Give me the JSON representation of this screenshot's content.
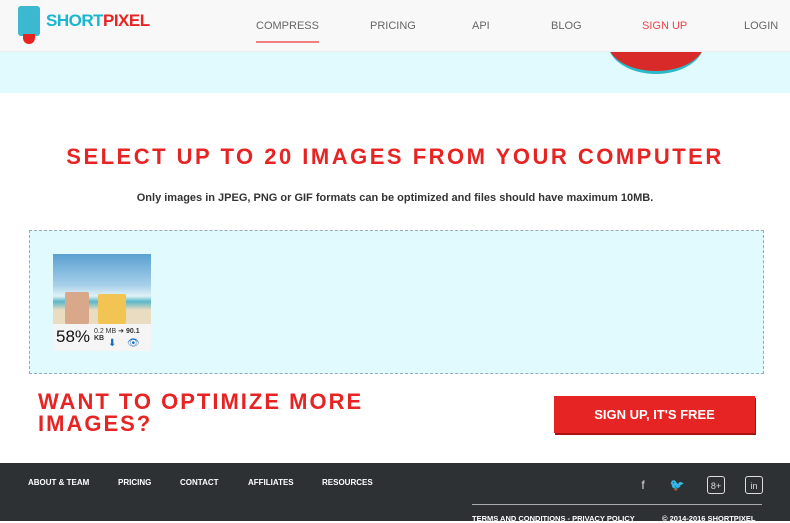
{
  "header": {
    "logo_a": "SHORT",
    "logo_b": "PIXEL",
    "nav": [
      {
        "label": "COMPRESS"
      },
      {
        "label": "PRICING"
      },
      {
        "label": "API"
      },
      {
        "label": "BLOG"
      },
      {
        "label": "SIGN UP"
      },
      {
        "label": "LOGIN"
      }
    ]
  },
  "main": {
    "title": "SELECT UP TO 20 IMAGES FROM YOUR COMPUTER",
    "subtitle": "Only images in JPEG, PNG or GIF formats can be optimized and files should have maximum 10MB.",
    "image": {
      "percent": "58%",
      "before": "0.2 MB",
      "after": "90.1 KB",
      "arrow": "➜"
    },
    "more": "WANT TO OPTIMIZE MORE IMAGES?",
    "cta": "SIGN UP, IT'S FREE"
  },
  "footer": {
    "links": [
      "ABOUT & TEAM",
      "PRICING",
      "CONTACT",
      "AFFILIATES",
      "RESOURCES"
    ],
    "social": [
      "facebook",
      "twitter",
      "google-plus",
      "linkedin"
    ],
    "terms": "TERMS AND CONDITIONS - PRIVACY POLICY",
    "copyright": "© 2014-2016 SHORTPIXEL"
  },
  "colors": {
    "accent": "#e62424",
    "brand_blue": "#19b6cf",
    "dropzone": "#e0fafd"
  }
}
